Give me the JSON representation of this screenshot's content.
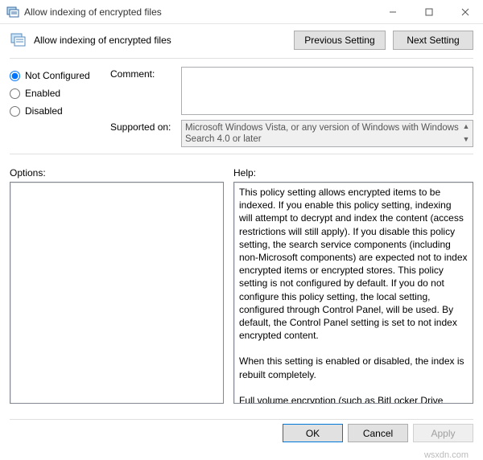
{
  "window": {
    "title": "Allow indexing of encrypted files"
  },
  "header": {
    "policy_title": "Allow indexing of encrypted files",
    "prev_btn": "Previous Setting",
    "next_btn": "Next Setting"
  },
  "state": {
    "not_configured": "Not Configured",
    "enabled": "Enabled",
    "disabled": "Disabled",
    "selected": "not_configured"
  },
  "form": {
    "comment_label": "Comment:",
    "comment_value": "",
    "supported_label": "Supported on:",
    "supported_value": "Microsoft Windows Vista, or any version of Windows with Windows Search 4.0 or later"
  },
  "sections": {
    "options_label": "Options:",
    "help_label": "Help:"
  },
  "help_text": "This policy setting allows encrypted items to be indexed. If you enable this policy setting, indexing  will attempt to decrypt and index the content (access restrictions will still apply). If you disable this policy setting, the search service components (including non-Microsoft components) are expected not to index encrypted items or encrypted stores. This policy setting is not configured by default. If you do not configure this policy setting, the local setting, configured through Control Panel, will be used. By default, the Control Panel setting is set to not index encrypted content.\n\nWhen this setting is enabled or disabled, the index is rebuilt completely.\n\nFull volume encryption (such as BitLocker Drive Encryption or a non-Microsoft solution) must be used for the location of the index to maintain security for encrypted files.",
  "footer": {
    "ok": "OK",
    "cancel": "Cancel",
    "apply": "Apply"
  },
  "watermark": "wsxdn.com"
}
